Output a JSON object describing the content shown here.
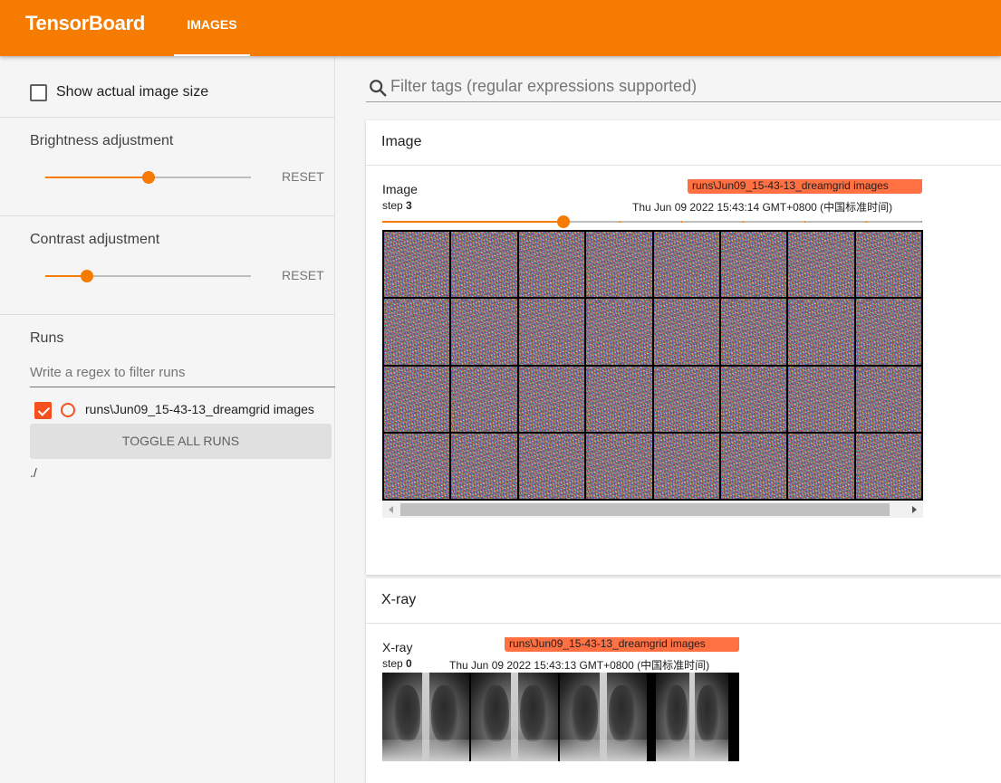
{
  "app": {
    "title": "TensorBoard"
  },
  "tabs": [
    {
      "label": "IMAGES"
    }
  ],
  "sidebar": {
    "show_actual_size": {
      "label": "Show actual image size",
      "checked": false
    },
    "brightness": {
      "title": "Brightness adjustment",
      "value": 0.5,
      "reset_label": "RESET"
    },
    "contrast": {
      "title": "Contrast adjustment",
      "value": 0.2,
      "reset_label": "RESET"
    },
    "runs": {
      "title": "Runs",
      "filter_placeholder": "Write a regex to filter runs",
      "items": [
        {
          "label": "runs\\Jun09_15-43-13_dreamgrid images",
          "checked": true
        }
      ],
      "toggle_label": "TOGGLE ALL RUNS",
      "path": "./"
    }
  },
  "main": {
    "search_placeholder": "Filter tags (regular expressions supported)",
    "cards": [
      {
        "header": "Image",
        "tag": "Image",
        "step_prefix": "step",
        "step": "3",
        "run_badge": "runs\\Jun09_15-43-13_dreamgrid images",
        "timestamp": "Thu Jun 09 2022 15:43:14 GMT+0800 (中国标准时间)",
        "step_progress": 0.33,
        "grid": {
          "rows": 4,
          "cols": 8
        }
      },
      {
        "header": "X-ray",
        "tag": "X-ray",
        "step_prefix": "step",
        "step": "0",
        "run_badge": "runs\\Jun09_15-43-13_dreamgrid images",
        "timestamp": "Thu Jun 09 2022 15:43:13 GMT+0800 (中国标准时间)",
        "image_count": 4
      }
    ]
  },
  "colors": {
    "accent": "#f57c00",
    "badge": "#ff7043",
    "checkbox": "#f4511e"
  },
  "icons": {
    "search": "search-icon"
  }
}
